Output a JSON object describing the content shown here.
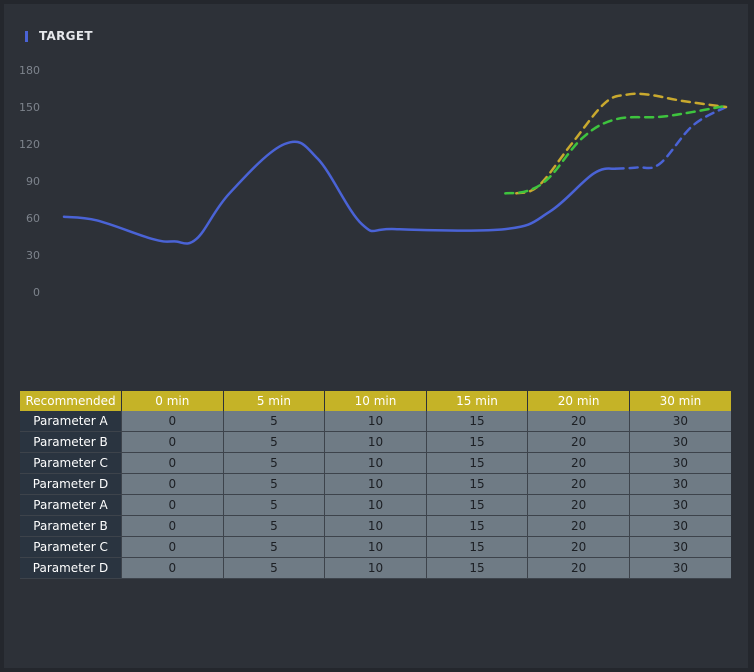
{
  "title": "TARGET",
  "colors": {
    "background": "#2d3138",
    "header": "#c5b327",
    "cell": "#6f7b85",
    "rowhead": "#2a3440",
    "blue": "#4a63d6",
    "yellow": "#c9a92e",
    "green": "#3ec43e"
  },
  "chart_data": {
    "type": "line",
    "title": "TARGET",
    "xlim": [
      0,
      30
    ],
    "ylim": [
      0,
      180
    ],
    "yticks": [
      "180",
      "150",
      "120",
      "90",
      "60",
      "30",
      "0"
    ],
    "grid": false,
    "legend": "none",
    "series": [
      {
        "color": "#4a63d6",
        "style": "solid",
        "points": [
          [
            0,
            61
          ],
          [
            1.5,
            58
          ],
          [
            4,
            43
          ],
          [
            5,
            41
          ],
          [
            6,
            43
          ],
          [
            7.5,
            80
          ],
          [
            10,
            120
          ],
          [
            11.5,
            108
          ],
          [
            13.5,
            55
          ],
          [
            15,
            51
          ],
          [
            20,
            51
          ],
          [
            22,
            65
          ],
          [
            24,
            96
          ],
          [
            25,
            100
          ]
        ]
      },
      {
        "color": "#4a63d6",
        "style": "dashed",
        "points": [
          [
            25,
            100
          ],
          [
            26,
            101
          ],
          [
            27,
            104
          ],
          [
            28.5,
            135
          ],
          [
            30,
            150
          ]
        ]
      },
      {
        "color": "#c9a92e",
        "style": "dashed",
        "points": [
          [
            20.5,
            80
          ],
          [
            21.5,
            86
          ],
          [
            23,
            120
          ],
          [
            24.5,
            153
          ],
          [
            25.5,
            160
          ],
          [
            26.5,
            160
          ],
          [
            28,
            155
          ],
          [
            30,
            150
          ]
        ]
      },
      {
        "color": "#3ec43e",
        "style": "dashed",
        "points": [
          [
            20,
            80
          ],
          [
            21,
            82
          ],
          [
            22,
            93
          ],
          [
            23.5,
            125
          ],
          [
            25,
            140
          ],
          [
            27,
            142
          ],
          [
            28.5,
            146
          ],
          [
            30,
            151
          ]
        ]
      }
    ]
  },
  "table": {
    "headers": [
      "Recommended",
      "0 min",
      "5 min",
      "10 min",
      "15 min",
      "20 min",
      "30 min"
    ],
    "rows": [
      [
        "Parameter A",
        "0",
        "5",
        "10",
        "15",
        "20",
        "30"
      ],
      [
        "Parameter B",
        "0",
        "5",
        "10",
        "15",
        "20",
        "30"
      ],
      [
        "Parameter C",
        "0",
        "5",
        "10",
        "15",
        "20",
        "30"
      ],
      [
        "Parameter D",
        "0",
        "5",
        "10",
        "15",
        "20",
        "30"
      ],
      [
        "Parameter A",
        "0",
        "5",
        "10",
        "15",
        "20",
        "30"
      ],
      [
        "Parameter B",
        "0",
        "5",
        "10",
        "15",
        "20",
        "30"
      ],
      [
        "Parameter C",
        "0",
        "5",
        "10",
        "15",
        "20",
        "30"
      ],
      [
        "Parameter D",
        "0",
        "5",
        "10",
        "15",
        "20",
        "30"
      ]
    ]
  }
}
